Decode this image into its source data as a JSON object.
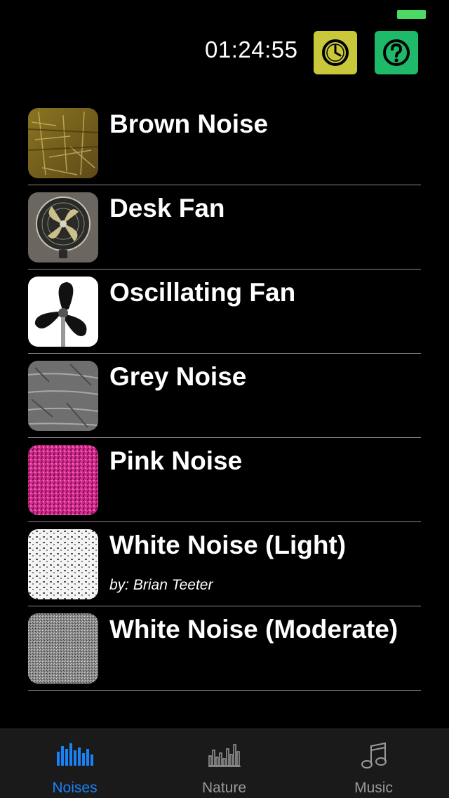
{
  "status_bar": {
    "battery_color": "#4cd964"
  },
  "header": {
    "timer_text": "01:24:55",
    "timer_button_icon": "clock-icon",
    "help_button_icon": "question-icon",
    "timer_button_color": "#c9c83a",
    "help_button_color": "#1fb96a"
  },
  "sounds": [
    {
      "title": "Brown Noise",
      "subtitle": ""
    },
    {
      "title": "Desk Fan",
      "subtitle": ""
    },
    {
      "title": "Oscillating Fan",
      "subtitle": ""
    },
    {
      "title": "Grey Noise",
      "subtitle": ""
    },
    {
      "title": "Pink Noise",
      "subtitle": ""
    },
    {
      "title": "White Noise (Light)",
      "subtitle": "by: Brian Teeter"
    },
    {
      "title": "White Noise (Moderate)",
      "subtitle": ""
    }
  ],
  "tabs": [
    {
      "label": "Noises",
      "icon": "equalizer-bars-icon",
      "selected": true
    },
    {
      "label": "Nature",
      "icon": "nature-bars-icon",
      "selected": false
    },
    {
      "label": "Music",
      "icon": "music-note-icon",
      "selected": false
    }
  ],
  "colors": {
    "tab_selected": "#1a82f7",
    "tab_unselected": "#9a9a9a"
  }
}
